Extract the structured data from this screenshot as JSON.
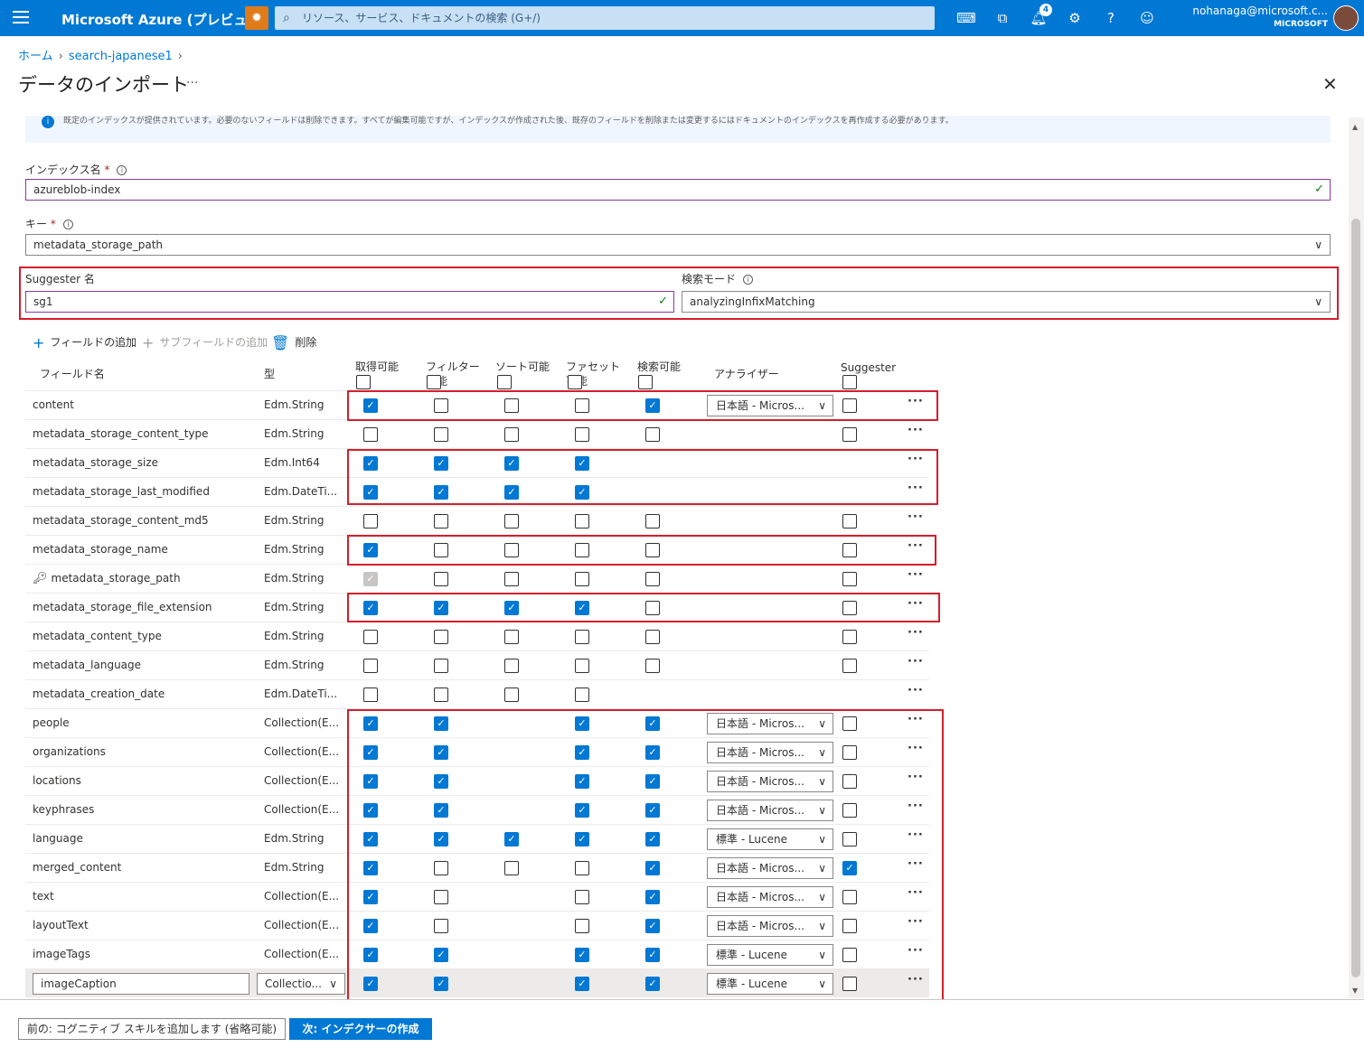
{
  "topbar": {
    "brand": "Microsoft Azure (プレビュー)",
    "search_placeholder": "リソース、サービス、ドキュメントの検索 (G+/)",
    "notification_count": "4",
    "account_name": "nohanaga@microsoft.c...",
    "account_tenant": "MICROSOFT",
    "accent_color": "#0078d4"
  },
  "breadcrumb": {
    "home": "ホーム",
    "resource": "search-japanese1"
  },
  "page": {
    "title": "データのインポート",
    "more": "···"
  },
  "info_text": "既定のインデックスが提供されています。必要のないフィールドは削除できます。すべてが編集可能ですが、インデックスが作成された後、既存のフィールドを削除または変更するにはドキュメントのインデックスを再作成する必要があります。",
  "form": {
    "index_name_label": "インデックス名",
    "index_name_value": "azureblob-index",
    "key_label": "キー",
    "key_value": "metadata_storage_path",
    "suggester_name_label": "Suggester 名",
    "suggester_name_value": "sg1",
    "search_mode_label": "検索モード",
    "search_mode_value": "analyzingInfixMatching",
    "required_mark": "*"
  },
  "toolbar": {
    "add_field": "フィールドの追加",
    "add_subfield": "サブフィールドの追加",
    "delete": "削除"
  },
  "columns": {
    "name": "フィールド名",
    "type": "型",
    "retrievable": "取得可能",
    "filterable": "フィルター可能",
    "sortable": "ソート可能",
    "facetable": "ファセット可能",
    "searchable": "検索可能",
    "analyzer": "アナライザー",
    "suggester": "Suggester"
  },
  "fields": [
    {
      "name": "content",
      "type": "Edm.String",
      "flags": [
        1,
        0,
        0,
        0,
        1,
        0
      ],
      "analyzer": "日本語 - Micros..."
    },
    {
      "name": "metadata_storage_content_type",
      "type": "Edm.String",
      "flags": [
        0,
        0,
        0,
        0,
        0,
        0
      ],
      "analyzer": ""
    },
    {
      "name": "metadata_storage_size",
      "type": "Edm.Int64",
      "flags": [
        1,
        1,
        1,
        1,
        -1,
        -1
      ],
      "analyzer": ""
    },
    {
      "name": "metadata_storage_last_modified",
      "type": "Edm.DateTi...",
      "flags": [
        1,
        1,
        1,
        1,
        -1,
        -1
      ],
      "analyzer": ""
    },
    {
      "name": "metadata_storage_content_md5",
      "type": "Edm.String",
      "flags": [
        0,
        0,
        0,
        0,
        0,
        0
      ],
      "analyzer": ""
    },
    {
      "name": "metadata_storage_name",
      "type": "Edm.String",
      "flags": [
        1,
        0,
        0,
        0,
        0,
        0
      ],
      "analyzer": ""
    },
    {
      "name": "metadata_storage_path",
      "type": "Edm.String",
      "flags": [
        2,
        0,
        0,
        0,
        0,
        0
      ],
      "analyzer": "",
      "key": true
    },
    {
      "name": "metadata_storage_file_extension",
      "type": "Edm.String",
      "flags": [
        1,
        1,
        1,
        1,
        0,
        0
      ],
      "analyzer": ""
    },
    {
      "name": "metadata_content_type",
      "type": "Edm.String",
      "flags": [
        0,
        0,
        0,
        0,
        0,
        0
      ],
      "analyzer": ""
    },
    {
      "name": "metadata_language",
      "type": "Edm.String",
      "flags": [
        0,
        0,
        0,
        0,
        0,
        0
      ],
      "analyzer": ""
    },
    {
      "name": "metadata_creation_date",
      "type": "Edm.DateTi...",
      "flags": [
        0,
        0,
        0,
        0,
        -1,
        -1
      ],
      "analyzer": ""
    },
    {
      "name": "people",
      "type": "Collection(E...",
      "flags": [
        1,
        1,
        -1,
        1,
        1,
        0
      ],
      "analyzer": "日本語 - Micros..."
    },
    {
      "name": "organizations",
      "type": "Collection(E...",
      "flags": [
        1,
        1,
        -1,
        1,
        1,
        0
      ],
      "analyzer": "日本語 - Micros..."
    },
    {
      "name": "locations",
      "type": "Collection(E...",
      "flags": [
        1,
        1,
        -1,
        1,
        1,
        0
      ],
      "analyzer": "日本語 - Micros..."
    },
    {
      "name": "keyphrases",
      "type": "Collection(E...",
      "flags": [
        1,
        1,
        -1,
        1,
        1,
        0
      ],
      "analyzer": "日本語 - Micros..."
    },
    {
      "name": "language",
      "type": "Edm.String",
      "flags": [
        1,
        1,
        1,
        1,
        1,
        0
      ],
      "analyzer": "標準 - Lucene"
    },
    {
      "name": "merged_content",
      "type": "Edm.String",
      "flags": [
        1,
        0,
        0,
        0,
        1,
        1
      ],
      "analyzer": "日本語 - Micros..."
    },
    {
      "name": "text",
      "type": "Collection(E...",
      "flags": [
        1,
        0,
        -1,
        0,
        1,
        0
      ],
      "analyzer": "日本語 - Micros..."
    },
    {
      "name": "layoutText",
      "type": "Collection(E...",
      "flags": [
        1,
        0,
        -1,
        0,
        1,
        0
      ],
      "analyzer": "日本語 - Micros..."
    },
    {
      "name": "imageTags",
      "type": "Collection(E...",
      "flags": [
        1,
        1,
        -1,
        1,
        1,
        0
      ],
      "analyzer": "標準 - Lucene"
    },
    {
      "name": "imageCaption",
      "type": "Collectio...",
      "flags": [
        1,
        1,
        -1,
        1,
        1,
        0
      ],
      "analyzer": "標準 - Lucene",
      "editing": true
    }
  ],
  "footer": {
    "prev_button": "前の: コグニティブ スキルを追加します (省略可能)",
    "next_button": "次: インデクサーの作成"
  },
  "highlight_color": "#d61d2b"
}
